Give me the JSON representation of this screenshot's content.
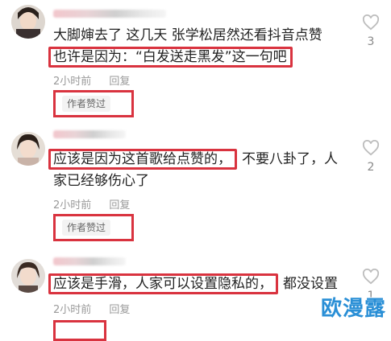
{
  "comments": [
    {
      "lines": [
        "大脚婶去了 这几天 张学松居然还看抖音点赞",
        "也许是因为：“白发送走黑发”这一句吧"
      ],
      "time": "2小时前",
      "reply": "回复",
      "author_badge": "作者赞过",
      "likes": "3"
    },
    {
      "line1_highlight": "应该是因为这首歌给点赞的，",
      "line1_rest": "不要八卦了，人",
      "line2": "家已经够伤心了",
      "time": "2小时前",
      "reply": "回复",
      "author_badge": "作者赞过",
      "likes": "2"
    },
    {
      "line1_highlight": "应该是手滑，人家可以设置隐私的，",
      "line1_rest": "都没设置",
      "time": "2小时前",
      "reply": "回复",
      "likes": "1"
    }
  ],
  "watermark": "欧漫露",
  "colors": {
    "highlight_border": "#d9333f",
    "meta_text": "#9a9a9a",
    "watermark": "#2a8fd6"
  }
}
